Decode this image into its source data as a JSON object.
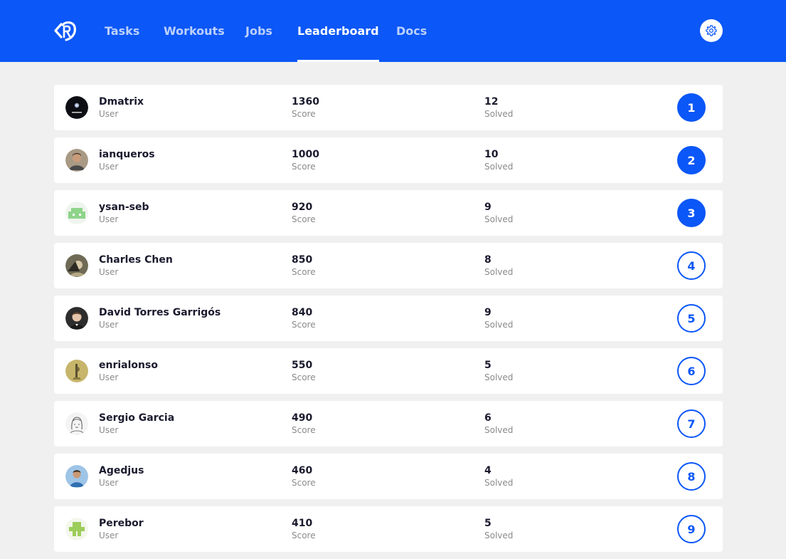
{
  "nav": {
    "links": [
      {
        "label": "Tasks",
        "active": false
      },
      {
        "label": "Workouts",
        "active": false
      },
      {
        "label": "Jobs",
        "active": false
      },
      {
        "label": "Leaderboard",
        "active": true
      },
      {
        "label": "Docs",
        "active": false
      }
    ],
    "accent": "#0b57f7"
  },
  "rows": [
    {
      "name": "Dmatrix",
      "role": "User",
      "score": "1360",
      "score_label": "Score",
      "solved": "12",
      "solved_label": "Solved",
      "rank": "1",
      "top": true,
      "avatar": "dark-avatar-icon"
    },
    {
      "name": "ianqueros",
      "role": "User",
      "score": "1000",
      "score_label": "Score",
      "solved": "10",
      "solved_label": "Solved",
      "rank": "2",
      "top": true,
      "avatar": "photo-avatar-icon"
    },
    {
      "name": "ysan-seb",
      "role": "User",
      "score": "920",
      "score_label": "Score",
      "solved": "9",
      "solved_label": "Solved",
      "rank": "3",
      "top": true,
      "avatar": "green-identicon-icon"
    },
    {
      "name": "Charles Chen",
      "role": "User",
      "score": "850",
      "score_label": "Score",
      "solved": "8",
      "solved_label": "Solved",
      "rank": "4",
      "top": false,
      "avatar": "photo-avatar-icon"
    },
    {
      "name": "David Torres Garrigós",
      "role": "User",
      "score": "840",
      "score_label": "Score",
      "solved": "9",
      "solved_label": "Solved",
      "rank": "5",
      "top": false,
      "avatar": "photo-avatar-icon"
    },
    {
      "name": "enrialonso",
      "role": "User",
      "score": "550",
      "score_label": "Score",
      "solved": "5",
      "solved_label": "Solved",
      "rank": "6",
      "top": false,
      "avatar": "photo-avatar-icon"
    },
    {
      "name": "Sergio Garcia",
      "role": "User",
      "score": "490",
      "score_label": "Score",
      "solved": "6",
      "solved_label": "Solved",
      "rank": "7",
      "top": false,
      "avatar": "sketch-avatar-icon"
    },
    {
      "name": "Agedjus",
      "role": "User",
      "score": "460",
      "score_label": "Score",
      "solved": "4",
      "solved_label": "Solved",
      "rank": "8",
      "top": false,
      "avatar": "photo-avatar-icon"
    },
    {
      "name": "Perebor",
      "role": "User",
      "score": "410",
      "score_label": "Score",
      "solved": "5",
      "solved_label": "Solved",
      "rank": "9",
      "top": false,
      "avatar": "lime-identicon-icon"
    }
  ]
}
